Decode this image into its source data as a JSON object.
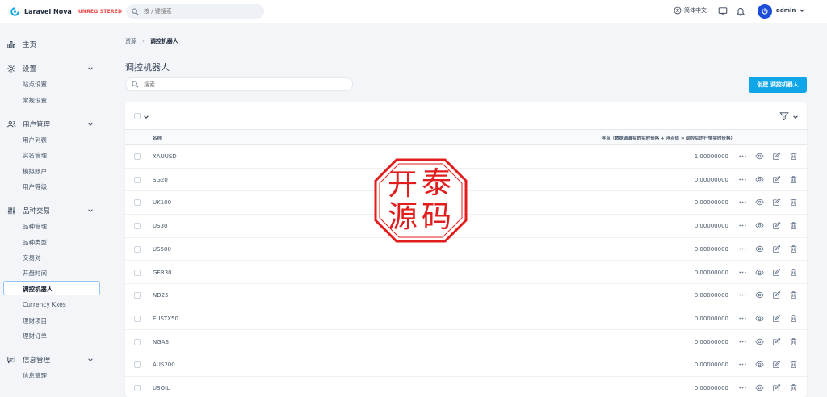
{
  "app": {
    "name": "Laravel Nova",
    "badge": "UNREGISTERED"
  },
  "topbar": {
    "search_placeholder": "按 / 键搜索",
    "language": "简体中文",
    "user": "admin"
  },
  "sidebar": {
    "sections": [
      {
        "label": "主页",
        "icon": "chart-bar-icon"
      },
      {
        "label": "设置",
        "icon": "gear-icon",
        "items": [
          "站点设置",
          "常规设置"
        ]
      },
      {
        "label": "用户管理",
        "icon": "users-icon",
        "items": [
          "用户列表",
          "实名管理",
          "模拟账户",
          "用户等级"
        ]
      },
      {
        "label": "品种交易",
        "icon": "sliders-icon",
        "items": [
          "品种管理",
          "品种类型",
          "交易对",
          "开盘时间",
          "调控机器人",
          "Currency Kxes",
          "理财项目",
          "理财订单"
        ]
      },
      {
        "label": "信息管理",
        "icon": "chat-icon",
        "items": [
          "信息管理"
        ]
      }
    ],
    "active_item": "调控机器人"
  },
  "main": {
    "breadcrumb": [
      "资源",
      "调控机器人"
    ],
    "title": "调控机器人",
    "search_placeholder": "搜索",
    "create_label": "创建 调控机器人",
    "columns": {
      "name": "名称",
      "float": "浮点（数据源真实的实时价格 + 浮点值 = 调控后的行情实时价格）"
    },
    "rows": [
      {
        "name": "XAUUSD",
        "value": "1.00000000"
      },
      {
        "name": "SG20",
        "value": "0.00000000"
      },
      {
        "name": "UK100",
        "value": "0.00000000"
      },
      {
        "name": "US30",
        "value": "0.00000000"
      },
      {
        "name": "US500",
        "value": "0.00000000"
      },
      {
        "name": "GER30",
        "value": "0.00000000"
      },
      {
        "name": "ND25",
        "value": "0.00000000"
      },
      {
        "name": "EUSTX50",
        "value": "0.00000000"
      },
      {
        "name": "NGAS",
        "value": "0.00000000"
      },
      {
        "name": "AUS200",
        "value": "0.00000000"
      },
      {
        "name": "USOIL",
        "value": "0.00000000"
      }
    ]
  },
  "watermark": {
    "chars": [
      "开",
      "泰",
      "源",
      "码"
    ],
    "color": "#e11d1d"
  },
  "colors": {
    "accent": "#0ea5e9",
    "active_border": "#93c5fd",
    "avatar": "#1d4ed8",
    "badge": "#ef4444"
  }
}
